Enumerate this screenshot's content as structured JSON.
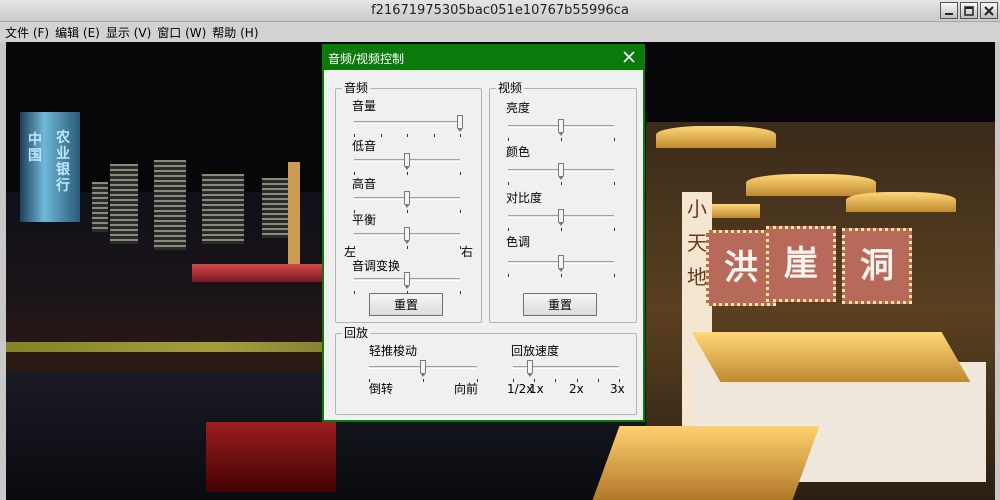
{
  "window": {
    "title": "f21671975305bac051e10767b55996ca"
  },
  "menu": {
    "items": [
      "文件 (F)",
      "编辑 (E)",
      "显示 (V)",
      "窗口 (W)",
      "帮助 (H)"
    ]
  },
  "video": {
    "tower_text_left": "中国",
    "tower_text_right": "农业银行",
    "signs": [
      "洪",
      "崖",
      "洞"
    ],
    "vertical_sign": "小天地"
  },
  "dialog": {
    "title": "音频/视频控制",
    "audio": {
      "group_label": "音频",
      "volume_label": "音量",
      "volume_level": 1.0,
      "bass_label": "低音",
      "bass_level": 0.5,
      "treble_label": "高音",
      "treble_level": 0.5,
      "balance_label": "平衡",
      "balance_level": 0.5,
      "balance_left": "左",
      "balance_right": "右",
      "pitch_label": "音调变换",
      "pitch_level": 0.5,
      "reset_label": "重置"
    },
    "video": {
      "group_label": "视频",
      "brightness_label": "亮度",
      "brightness_level": 0.5,
      "color_label": "颜色",
      "color_level": 0.5,
      "contrast_label": "对比度",
      "contrast_level": 0.5,
      "hue_label": "色调",
      "hue_level": 0.5,
      "reset_label": "重置"
    },
    "playback": {
      "group_label": "回放",
      "jog_label": "轻推梭动",
      "jog_level": 0.5,
      "jog_left": "倒转",
      "jog_right": "向前",
      "speed_label": "回放速度",
      "speed_level": 0.16,
      "speed_ticks": [
        "1/2x",
        "1x",
        "2x",
        "3x"
      ]
    }
  }
}
